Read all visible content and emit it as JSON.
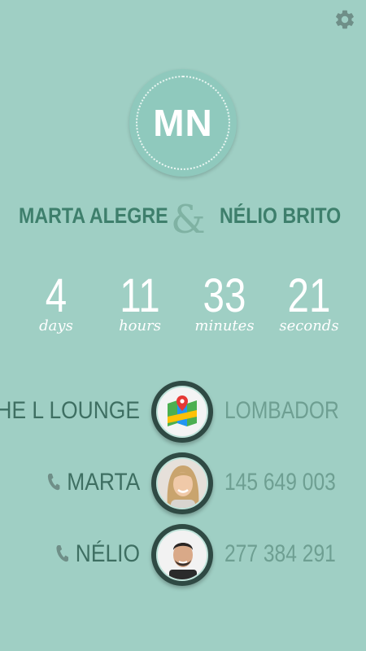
{
  "settings": {
    "icon": "gear-icon"
  },
  "monogram": {
    "initials": "MN"
  },
  "couple": {
    "name_left": "MARTA ALEGRE",
    "ampersand": "&",
    "name_right": "NÉLIO  BRITO"
  },
  "countdown": [
    {
      "value": "4",
      "unit": "days"
    },
    {
      "value": "11",
      "unit": "hours"
    },
    {
      "value": "33",
      "unit": "minutes"
    },
    {
      "value": "21",
      "unit": "seconds"
    }
  ],
  "venue": {
    "name": "THE L LOUNGE",
    "icon": "map-icon",
    "location": "LOMBADOR"
  },
  "contacts": [
    {
      "name": "MARTA",
      "icon": "phone-icon",
      "phone": "145 649 003"
    },
    {
      "name": "NÉLIO",
      "icon": "phone-icon",
      "phone": "277 384 291"
    }
  ],
  "colors": {
    "background": "#9fcfc4",
    "accent": "#3e7f6c",
    "ring": "#2f4a44"
  }
}
